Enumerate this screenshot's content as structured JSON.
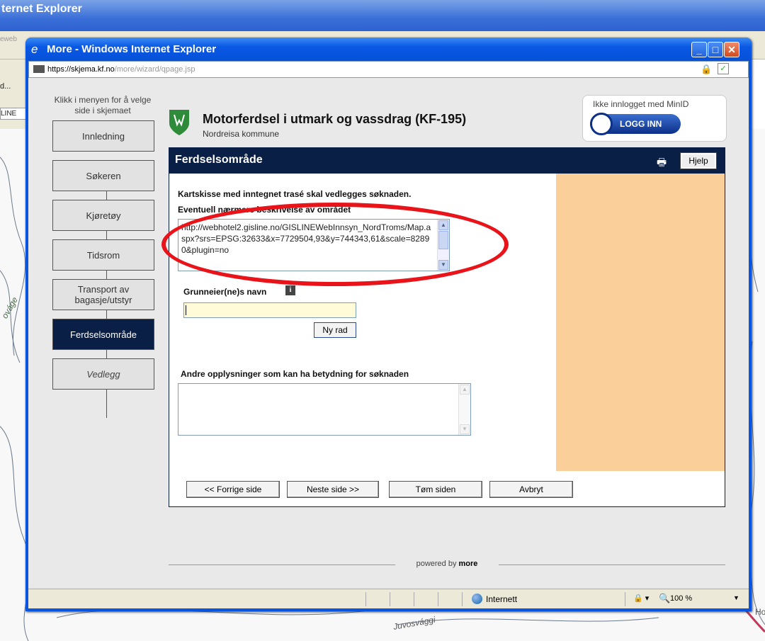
{
  "background": {
    "window_title": "ternet Explorer",
    "address_fragment": "eweb",
    "left_fragments": [
      "d...",
      "LINE",
      "⊕"
    ],
    "map_label": "Juvosvággi",
    "map_label2": "ováge",
    "map_label3": "Ho"
  },
  "popup": {
    "title": "More - Windows Internet Explorer",
    "url_host": "https://skjema.kf.no",
    "url_rest": "/more/wizard/qpage.jsp",
    "min_label": "_",
    "max_label": "□",
    "close_label": "✕",
    "status": {
      "zone": "Internett",
      "zoom": "100 %",
      "zoom_glyph": "🔍",
      "protect_glyph": "🔒 ▾",
      "arrow": "▼"
    }
  },
  "menu": {
    "hint": "Klikk i menyen for å velge side i skjemaet",
    "items": [
      {
        "label": "Innledning"
      },
      {
        "label": "Søkeren"
      },
      {
        "label": "Kjøretøy"
      },
      {
        "label": "Tidsrom"
      },
      {
        "label": "Transport av bagasje/utstyr"
      },
      {
        "label": "Ferdselsområde",
        "active": true
      },
      {
        "label": "Vedlegg"
      }
    ]
  },
  "header": {
    "title": "Motorferdsel i utmark og vassdrag (KF-195)",
    "subtitle": "Nordreisa kommune",
    "login_status": "Ikke innlogget med MinID",
    "login_button": "LOGG INN"
  },
  "panel": {
    "title": "Ferdselsområde",
    "help": "Hjelp",
    "print_glyph": "🖶",
    "note": "Kartskisse med inntegnet trasé skal vedlegges søknaden.",
    "desc_label": "Eventuell nærmere beskrivelse av området",
    "desc_value": "http://webhotel2.gisline.no/GISLINEWebInnsyn_NordTroms/Map.aspx?srs=EPSG:32633&x=7729504,93&y=744343,61&scale=82890&plugin=no",
    "owner_label": "Grunneier(ne)s navn",
    "owner_value": "",
    "info_glyph": "i",
    "new_row": "Ny rad",
    "other_label": "Andre opplysninger som kan ha betydning for søknaden",
    "other_value": "",
    "nav": {
      "prev": "<< Forrige side",
      "next": "Neste side >>",
      "clear": "Tøm siden",
      "cancel": "Avbryt"
    }
  },
  "footer": {
    "powered": "powered by",
    "brand": "more"
  },
  "colors": {
    "accent": "#0a1f45",
    "side_column": "#fbcf9a",
    "annotation": "#e8141a",
    "titlebar": "#0958e4"
  }
}
